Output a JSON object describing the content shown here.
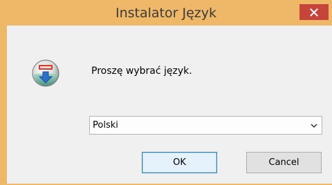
{
  "window": {
    "title": "Instalator Język",
    "title_bar_color": "#efb868",
    "close_button_color": "#c7443b"
  },
  "dialog": {
    "prompt": "Proszę wybrać język.",
    "icon": "installer-globe-icon",
    "language_select": {
      "selected_value": "Polski"
    },
    "buttons": {
      "ok_label": "OK",
      "cancel_label": "Cancel"
    }
  }
}
